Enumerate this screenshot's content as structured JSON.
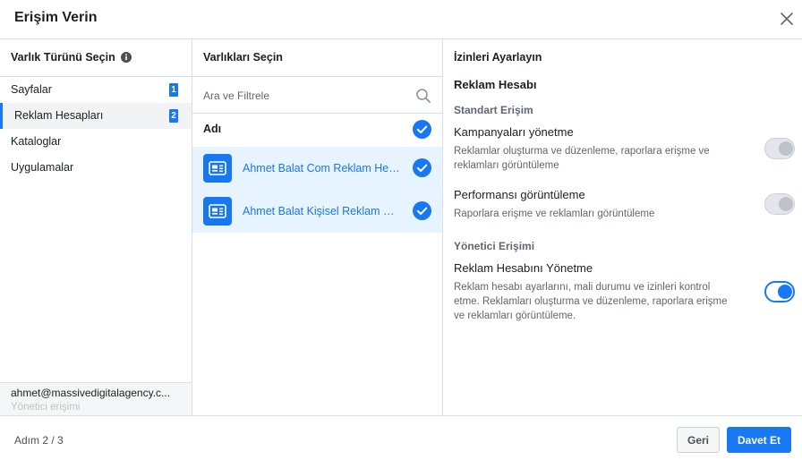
{
  "dialog": {
    "title": "Erişim Verin"
  },
  "asset_types": {
    "header": "Varlık Türünü Seçin",
    "items": [
      {
        "label": "Sayfalar",
        "badge": "1"
      },
      {
        "label": "Reklam Hesapları",
        "badge": "2"
      },
      {
        "label": "Kataloglar"
      },
      {
        "label": "Uygulamalar"
      }
    ],
    "user": {
      "email": "ahmet@massivedigitalagency.c...",
      "role": "Yönetici erişimi"
    }
  },
  "assets": {
    "header": "Varlıkları Seçin",
    "search_placeholder": "Ara ve Filtrele",
    "name_header": "Adı",
    "items": [
      {
        "name": "Ahmet Balat Com Reklam Hesabı"
      },
      {
        "name": "Ahmet Balat Kişisel Reklam Hesabı"
      }
    ]
  },
  "permissions": {
    "header": "İzinleri Ayarlayın",
    "asset_title": "Reklam Hesabı",
    "standard_label": "Standart Erişim",
    "admin_label": "Yönetici Erişimi",
    "items": [
      {
        "title": "Kampanyaları yönetme",
        "desc": "Reklamlar oluşturma ve düzenleme, raporlara erişme ve reklamları görüntüleme",
        "enabled": false
      },
      {
        "title": "Performansı görüntüleme",
        "desc": "Raporlara erişme ve reklamları görüntüleme",
        "enabled": false
      },
      {
        "title": "Reklam Hesabını Yönetme",
        "desc": "Reklam hesabı ayarlarını, mali durumu ve izinleri kontrol etme. Reklamları oluşturma ve düzenleme, raporlara erişme ve reklamları görüntüleme.",
        "enabled": true
      }
    ]
  },
  "footer": {
    "step": "Adım 2 / 3",
    "back_label": "Geri",
    "invite_label": "Davet Et"
  },
  "colors": {
    "accent": "#1877f2",
    "selected_row_bg": "#e7f3ff",
    "border": "#dadde1"
  },
  "icons": {
    "close": "close-icon",
    "info": "info-icon",
    "search": "search-icon",
    "check": "check-circle-icon",
    "ad_account": "ad-account-icon"
  }
}
